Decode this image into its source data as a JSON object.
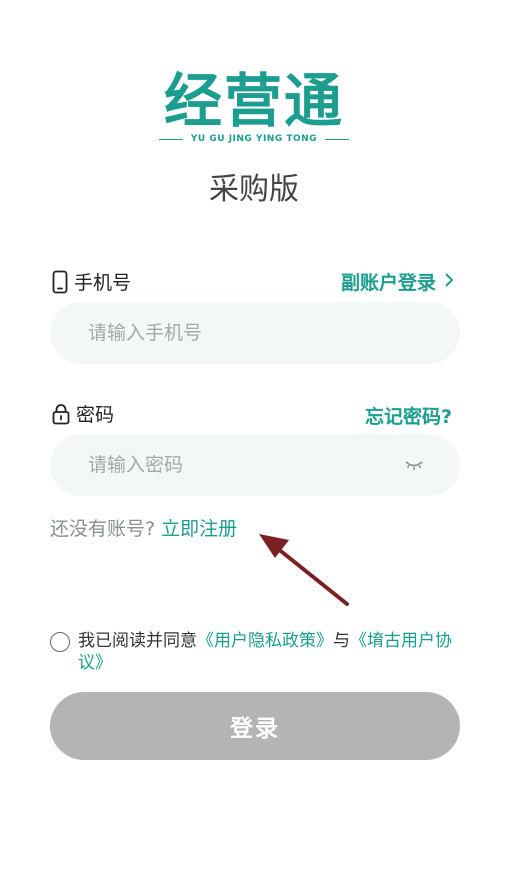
{
  "logo": {
    "title": "经营通",
    "subtitle": "YU GU JING YING TONG"
  },
  "edition": "采购版",
  "phone": {
    "label": "手机号",
    "sub_account_link": "副账户登录",
    "placeholder": "请输入手机号"
  },
  "password": {
    "label": "密码",
    "forgot_link": "忘记密码?",
    "placeholder": "请输入密码"
  },
  "register": {
    "prompt": "还没有账号?",
    "link": "立即注册"
  },
  "agreement": {
    "prefix": "我已阅读并同意",
    "privacy_link": "《用户隐私政策》",
    "conjunction": "与",
    "terms_link": "《堉古用户协议》"
  },
  "login_button": "登录",
  "colors": {
    "accent": "#1b9e90",
    "input_bg": "#f3f7f6",
    "button_disabled": "#b4b4b4",
    "annotation_arrow": "#7a1f22"
  }
}
